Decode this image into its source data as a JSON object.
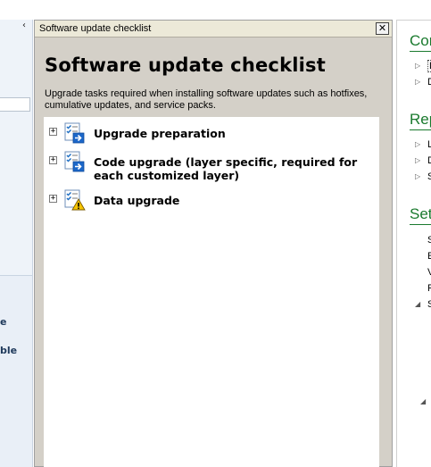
{
  "left_pane": {
    "collapse_glyph": "‹",
    "texts": [
      "e",
      "ble"
    ]
  },
  "dialog": {
    "title": "Software update checklist",
    "close_glyph": "✕",
    "heading": "Software update checklist",
    "description": "Upgrade tasks required when installing software updates such as hotfixes, cumulative updates, and service packs.",
    "tasks": [
      {
        "label": "Upgrade preparation",
        "expander": "+",
        "icon": "checklist-arrow-icon"
      },
      {
        "label": "Code upgrade (layer specific, required for each customized layer)",
        "expander": "+",
        "icon": "checklist-arrow-icon"
      },
      {
        "label": "Data upgrade",
        "expander": "+",
        "icon": "checklist-warning-icon"
      }
    ]
  },
  "right_pane": {
    "sections": [
      {
        "heading": "Cor",
        "items": [
          {
            "label": "L",
            "arrow": "▷",
            "focused": true
          },
          {
            "label": "D",
            "arrow": "▷"
          }
        ]
      },
      {
        "heading": "Rep",
        "items": [
          {
            "label": "L",
            "arrow": "▷"
          },
          {
            "label": "D",
            "arrow": "▷"
          },
          {
            "label": "S",
            "arrow": "▷"
          }
        ]
      },
      {
        "heading": "Set",
        "items": [
          {
            "label": "S"
          },
          {
            "label": "E"
          },
          {
            "label": "V"
          },
          {
            "label": "F"
          },
          {
            "label": "S",
            "arrow": "◢"
          }
        ]
      }
    ],
    "bottom_arrow": "◢"
  },
  "colors": {
    "dialog_bg": "#d4d0c8",
    "right_heading": "#1a7a2e",
    "left_text": "#1e395b"
  }
}
